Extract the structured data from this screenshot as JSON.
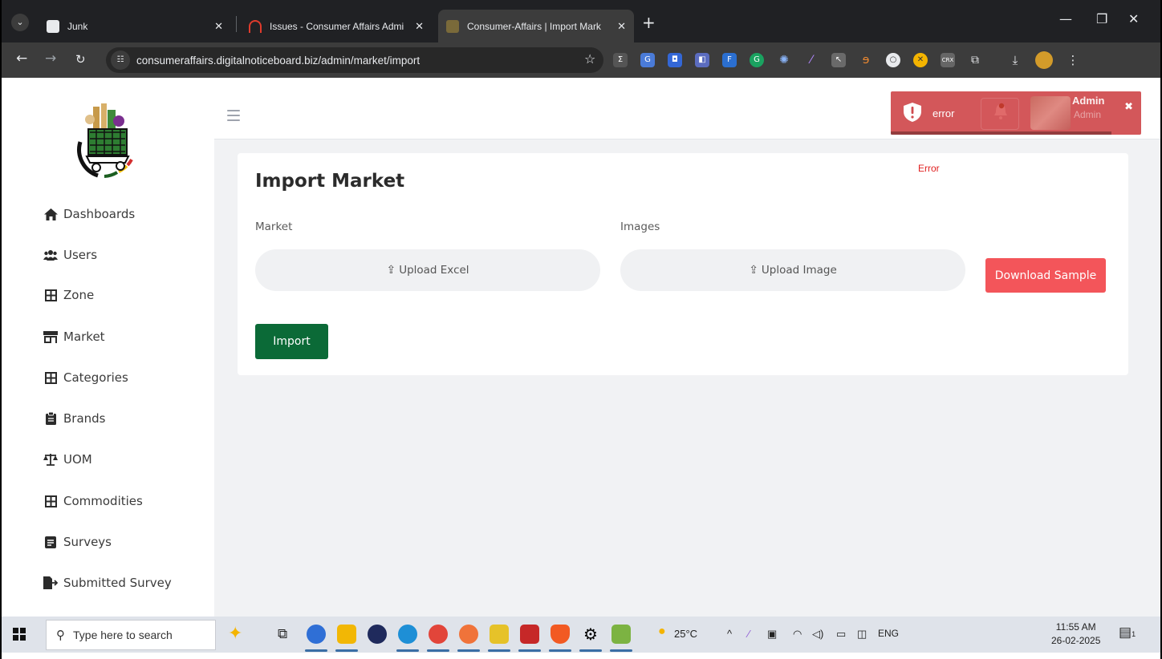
{
  "browser": {
    "tabs": [
      {
        "title": "Junk",
        "active": false
      },
      {
        "title": "Issues - Consumer Affairs Admi",
        "active": false
      },
      {
        "title": "Consumer-Affairs | Import Mark",
        "active": true
      }
    ],
    "url": "consumeraffairs.digitalnoticeboard.biz/admin/market/import"
  },
  "sidebar": {
    "items": [
      {
        "label": "Dashboards",
        "icon": "home-icon"
      },
      {
        "label": "Users",
        "icon": "users-icon"
      },
      {
        "label": "Zone",
        "icon": "grid-icon"
      },
      {
        "label": "Market",
        "icon": "store-icon"
      },
      {
        "label": "Categories",
        "icon": "grid-icon"
      },
      {
        "label": "Brands",
        "icon": "clipboard-icon"
      },
      {
        "label": "UOM",
        "icon": "scale-icon"
      },
      {
        "label": "Commodities",
        "icon": "grid-icon"
      },
      {
        "label": "Surveys",
        "icon": "form-icon"
      },
      {
        "label": "Submitted Survey",
        "icon": "file-export-icon"
      }
    ]
  },
  "header": {
    "toast_message": "error",
    "user_name": "Admin",
    "user_role": "Admin"
  },
  "page": {
    "title": "Import Market",
    "error_text": "Error",
    "market_label": "Market",
    "images_label": "Images",
    "upload_excel": "Upload Excel",
    "upload_image": "Upload Image",
    "download_sample": "Download Sample",
    "import_button": "Import"
  },
  "taskbar": {
    "search_placeholder": "Type here to search",
    "weather": "25°C",
    "language": "ENG",
    "time": "11:55 AM",
    "date": "26-02-2025",
    "notification_count": "1"
  },
  "colors": {
    "import_button": "#0b6a37",
    "download_button": "#f3555a",
    "toast": "#d04a4e",
    "error_text": "#e02020"
  }
}
